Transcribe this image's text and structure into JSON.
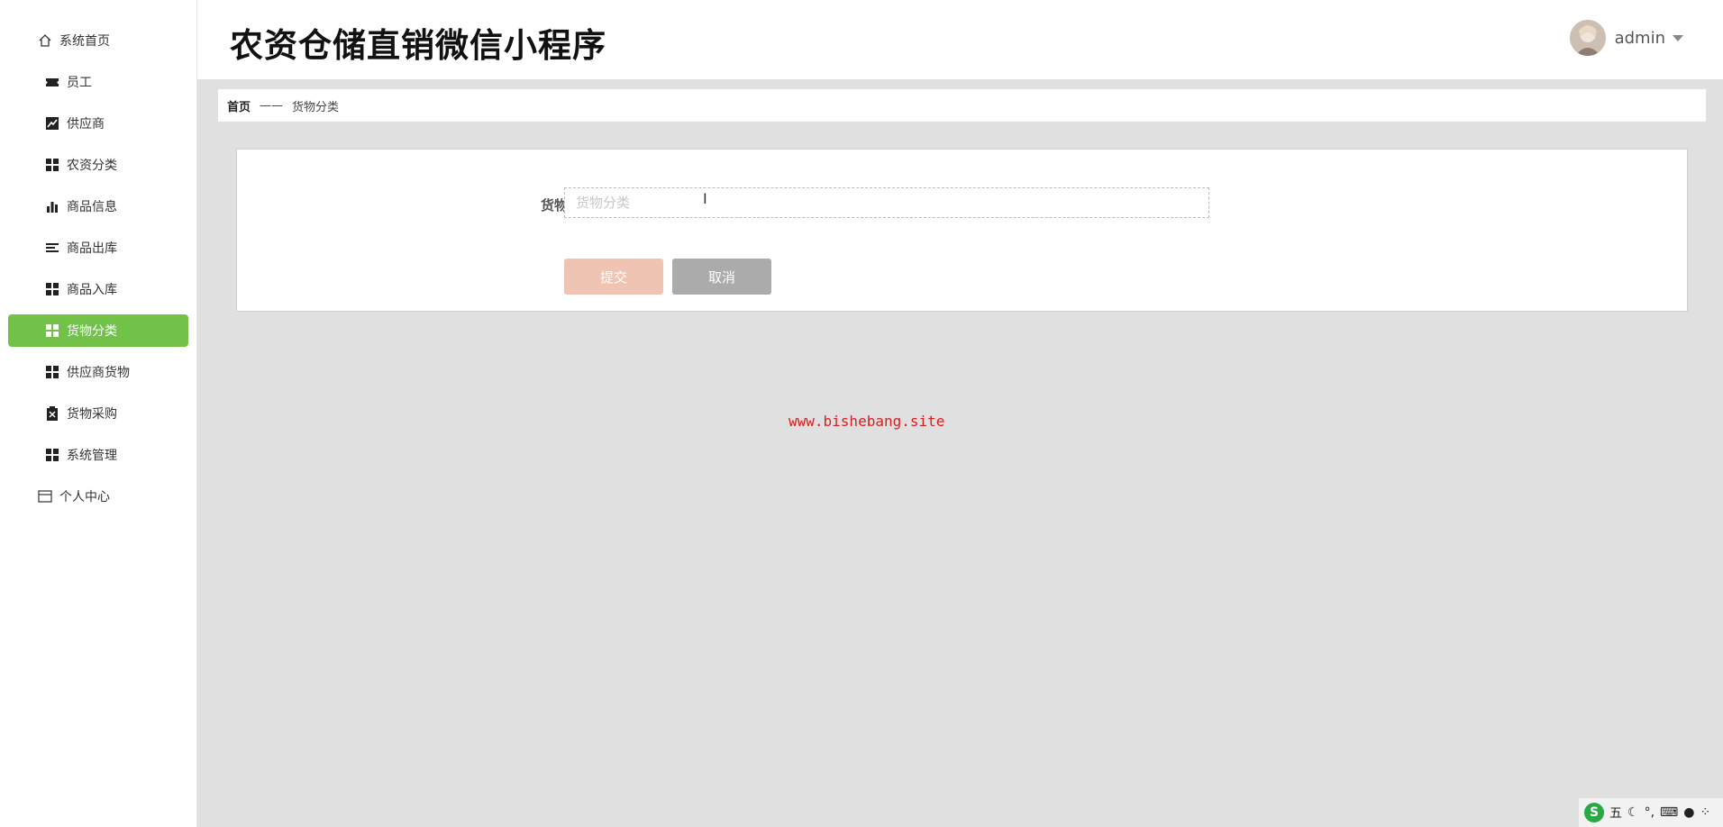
{
  "app": {
    "title": "农资仓储直销微信小程序"
  },
  "user": {
    "name": "admin"
  },
  "sidebar": {
    "items": [
      {
        "label": "系统首页",
        "icon": "home-icon"
      },
      {
        "label": "员工",
        "icon": "ticket-icon"
      },
      {
        "label": "供应商",
        "icon": "chart-icon"
      },
      {
        "label": "农资分类",
        "icon": "grid-icon"
      },
      {
        "label": "商品信息",
        "icon": "bar-chart-icon"
      },
      {
        "label": "商品出库",
        "icon": "list-icon"
      },
      {
        "label": "商品入库",
        "icon": "grid-icon"
      },
      {
        "label": "货物分类",
        "icon": "grid-icon",
        "active": true
      },
      {
        "label": "供应商货物",
        "icon": "grid-icon"
      },
      {
        "label": "货物采购",
        "icon": "clipboard-icon"
      },
      {
        "label": "系统管理",
        "icon": "grid-icon"
      },
      {
        "label": "个人中心",
        "icon": "card-icon"
      }
    ]
  },
  "breadcrumb": {
    "home": "首页",
    "separator": "——",
    "current": "货物分类"
  },
  "form": {
    "field_label": "货物分类",
    "field_placeholder": "货物分类",
    "field_value": "",
    "submit_label": "提交",
    "cancel_label": "取消"
  },
  "watermark": "www.bishebang.site",
  "tray": {
    "ime_label": "五"
  },
  "colors": {
    "active": "#72c24a",
    "submit": "#f0c4b3",
    "cancel": "#ababab",
    "watermark": "#d42020"
  }
}
